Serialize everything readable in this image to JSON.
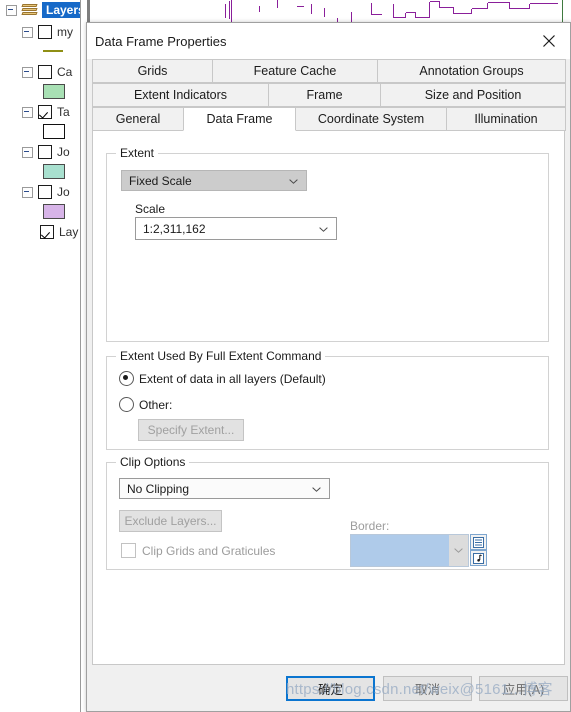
{
  "app": {
    "toc": {
      "root_label": "Layers",
      "items": [
        {
          "label": "my",
          "checked": false,
          "swatch": "line",
          "color": "#8f8f15"
        },
        {
          "label": "Ca",
          "checked": false,
          "swatch": "fill",
          "color": "#a8e0b4"
        },
        {
          "label": "Ta",
          "checked": true,
          "swatch": "fill",
          "color": "#ffffff"
        },
        {
          "label": "Jo",
          "checked": false,
          "swatch": "fill",
          "color": "#a8e0cf"
        },
        {
          "label": "Jo",
          "checked": false,
          "swatch": "fill",
          "color": "#d7b4e8"
        },
        {
          "label": "Lay",
          "checked": true,
          "swatch": "none",
          "color": "#ffffff"
        }
      ]
    },
    "map": {
      "feature_color": "#8a1f9a",
      "grid_color": "#3f7a3f"
    }
  },
  "dialog": {
    "title": "Data Frame Properties",
    "close_icon": "close-icon",
    "tabs": {
      "row1": [
        "Grids",
        "Feature Cache",
        "Annotation Groups"
      ],
      "row2": [
        "Extent Indicators",
        "Frame",
        "Size and Position"
      ],
      "row3": [
        "General",
        "Data Frame",
        "Coordinate System",
        "Illumination"
      ],
      "active": "Data Frame"
    },
    "extent_group": {
      "title": "Extent",
      "mode_value": "Fixed Scale",
      "scale_label": "Scale",
      "scale_value": "1:2,311,162"
    },
    "full_extent_group": {
      "title": "Extent Used By Full Extent Command",
      "option_default": "Extent of data in all layers (Default)",
      "option_other": "Other:",
      "specify_button": "Specify Extent...",
      "selected": "default"
    },
    "clip_group": {
      "title": "Clip Options",
      "clip_value": "No Clipping",
      "exclude_button": "Exclude Layers...",
      "clip_checkbox_label": "Clip Grids and Graticules",
      "clip_checkbox_checked": false,
      "border_label": "Border:",
      "border_color": "#afcbea",
      "border_more_icon": "palette-icon",
      "border_style_icon": "style-icon"
    },
    "footer": {
      "ok": "确定",
      "cancel": "取消",
      "apply": "应用(A)"
    }
  },
  "watermark": {
    "text": "https://blog.csdn.net/weix@5161...博客"
  }
}
